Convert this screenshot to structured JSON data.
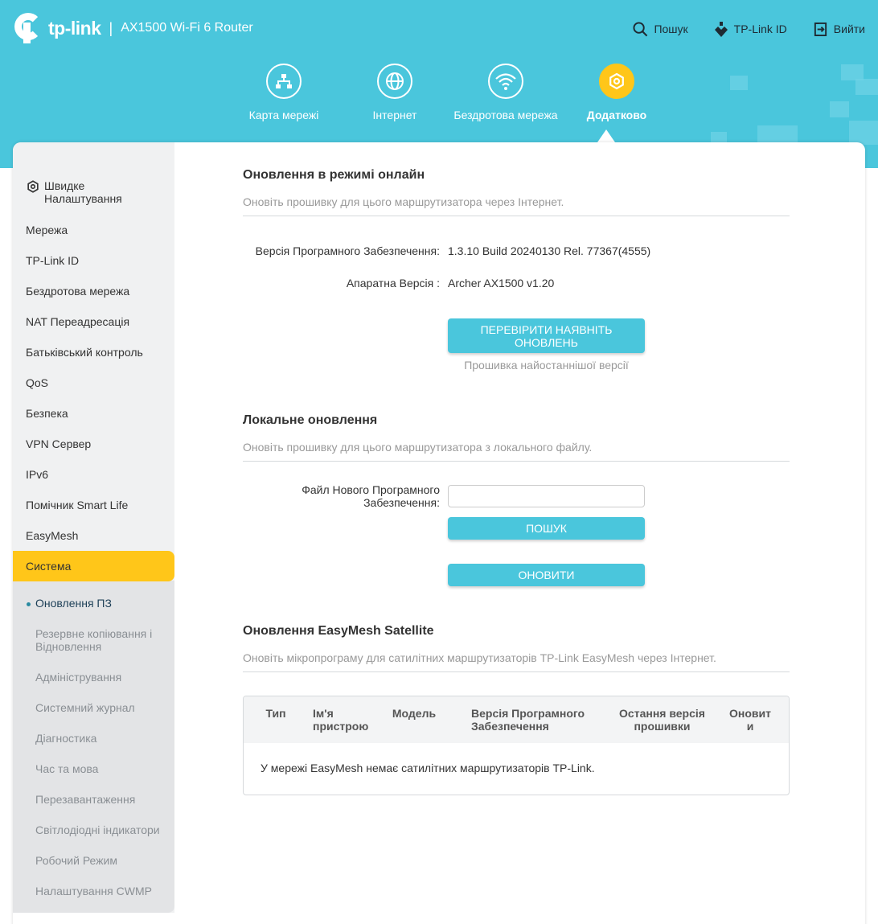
{
  "header": {
    "brand": "tp-link",
    "separator": "|",
    "model": "AX1500 Wi-Fi 6 Router",
    "actions": [
      {
        "label": "Пошук",
        "icon": "search-icon"
      },
      {
        "label": "TP-Link ID",
        "icon": "tplink-id-icon"
      },
      {
        "label": "Вийти",
        "icon": "logout-icon"
      }
    ],
    "nav": [
      {
        "label": "Карта мережі",
        "icon": "network-map-icon"
      },
      {
        "label": "Інтернет",
        "icon": "globe-icon"
      },
      {
        "label": "Бездротова мережа",
        "icon": "wifi-icon"
      },
      {
        "label": "Додатково",
        "icon": "gear-icon",
        "active": true
      }
    ]
  },
  "sidebar": {
    "items": [
      "Швидке Налаштування",
      "Мережа",
      "TP-Link ID",
      "Бездротова мережа",
      "NAT Переадресація",
      "Батьківський контроль",
      "QoS",
      "Безпека",
      "VPN Сервер",
      "IPv6",
      "Помічник Smart Life",
      "EasyMesh",
      "Система"
    ],
    "subitems": [
      "Оновлення ПЗ",
      "Резервне копіювання і Відновлення",
      "Адміністрування",
      "Системний журнал",
      "Діагностика",
      "Час та мова",
      "Перезавантаження",
      "Світлодіодні індикатори",
      "Робочий Режим",
      "Налаштування CWMP"
    ]
  },
  "online": {
    "title": "Оновлення в режимі онлайн",
    "desc": "Оновіть прошивку для цього маршрутизатора через Інтернет.",
    "fw_label": "Версія Програмного Забезпечення:",
    "fw_value": "1.3.10 Build 20240130 Rel. 77367(4555)",
    "hw_label": "Апаратна Версія :",
    "hw_value": "Archer AX1500 v1.20",
    "check_button": "ПЕРЕВІРИТИ НАЯВНІТЬ ОНОВЛЕНЬ",
    "status": "Прошивка найостаннішої версії"
  },
  "local": {
    "title": "Локальне оновлення",
    "desc": "Оновіть прошивку для цього маршрутизатора з локального файлу.",
    "file_label": "Файл Нового Програмного Забезпечення:",
    "browse_button": "ПОШУК",
    "update_button": "ОНОВИТИ"
  },
  "easymesh": {
    "title": "Оновлення EasyMesh Satellite",
    "desc": "Оновіть мікропрограму для сатилітних маршрутизаторів TP-Link EasyMesh через Інтернет.",
    "columns": [
      "Тип",
      "Ім'я пристрою",
      "Модель",
      "Версія Програмного Забезпечення",
      "Остання версія прошивки",
      "Оновити"
    ],
    "empty": "У мережі EasyMesh немає сатилітних маршрутизаторів TP-Link."
  },
  "colors": {
    "accent": "#4ac6dc",
    "active": "#ffc619"
  }
}
